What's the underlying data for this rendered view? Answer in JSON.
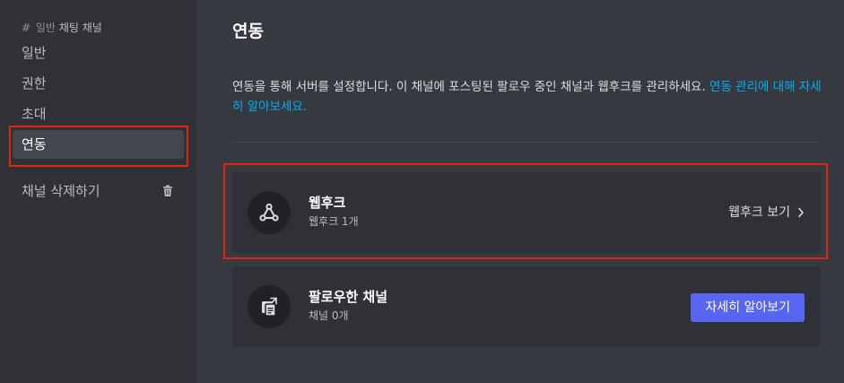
{
  "sidebar": {
    "header": {
      "hash": "#",
      "category": "일반",
      "channel": "채팅 채널"
    },
    "items": [
      {
        "label": "일반"
      },
      {
        "label": "권한"
      },
      {
        "label": "초대"
      },
      {
        "label": "연동",
        "active": true
      }
    ],
    "delete_label": "채널 삭제하기"
  },
  "main": {
    "title": "연동",
    "description": "연동을 통해 서버를 설정합니다. 이 채널에 포스팅된 팔로우 중인 채널과 웹후크를 관리하세요. ",
    "description_link": "연동 관리에 대해 자세히 알아보세요.",
    "webhooks": {
      "title": "웹후크",
      "subtitle": "웹후크 1개",
      "action_label": "웹후크 보기",
      "icon": "webhook-icon"
    },
    "followed": {
      "title": "팔로우한 채널",
      "subtitle": "채널 0개",
      "action_label": "자세히 알아보기",
      "icon": "followed-channel-icon"
    }
  },
  "colors": {
    "accent": "#5865f2",
    "link": "#00aff4",
    "highlight": "#e1260f"
  }
}
